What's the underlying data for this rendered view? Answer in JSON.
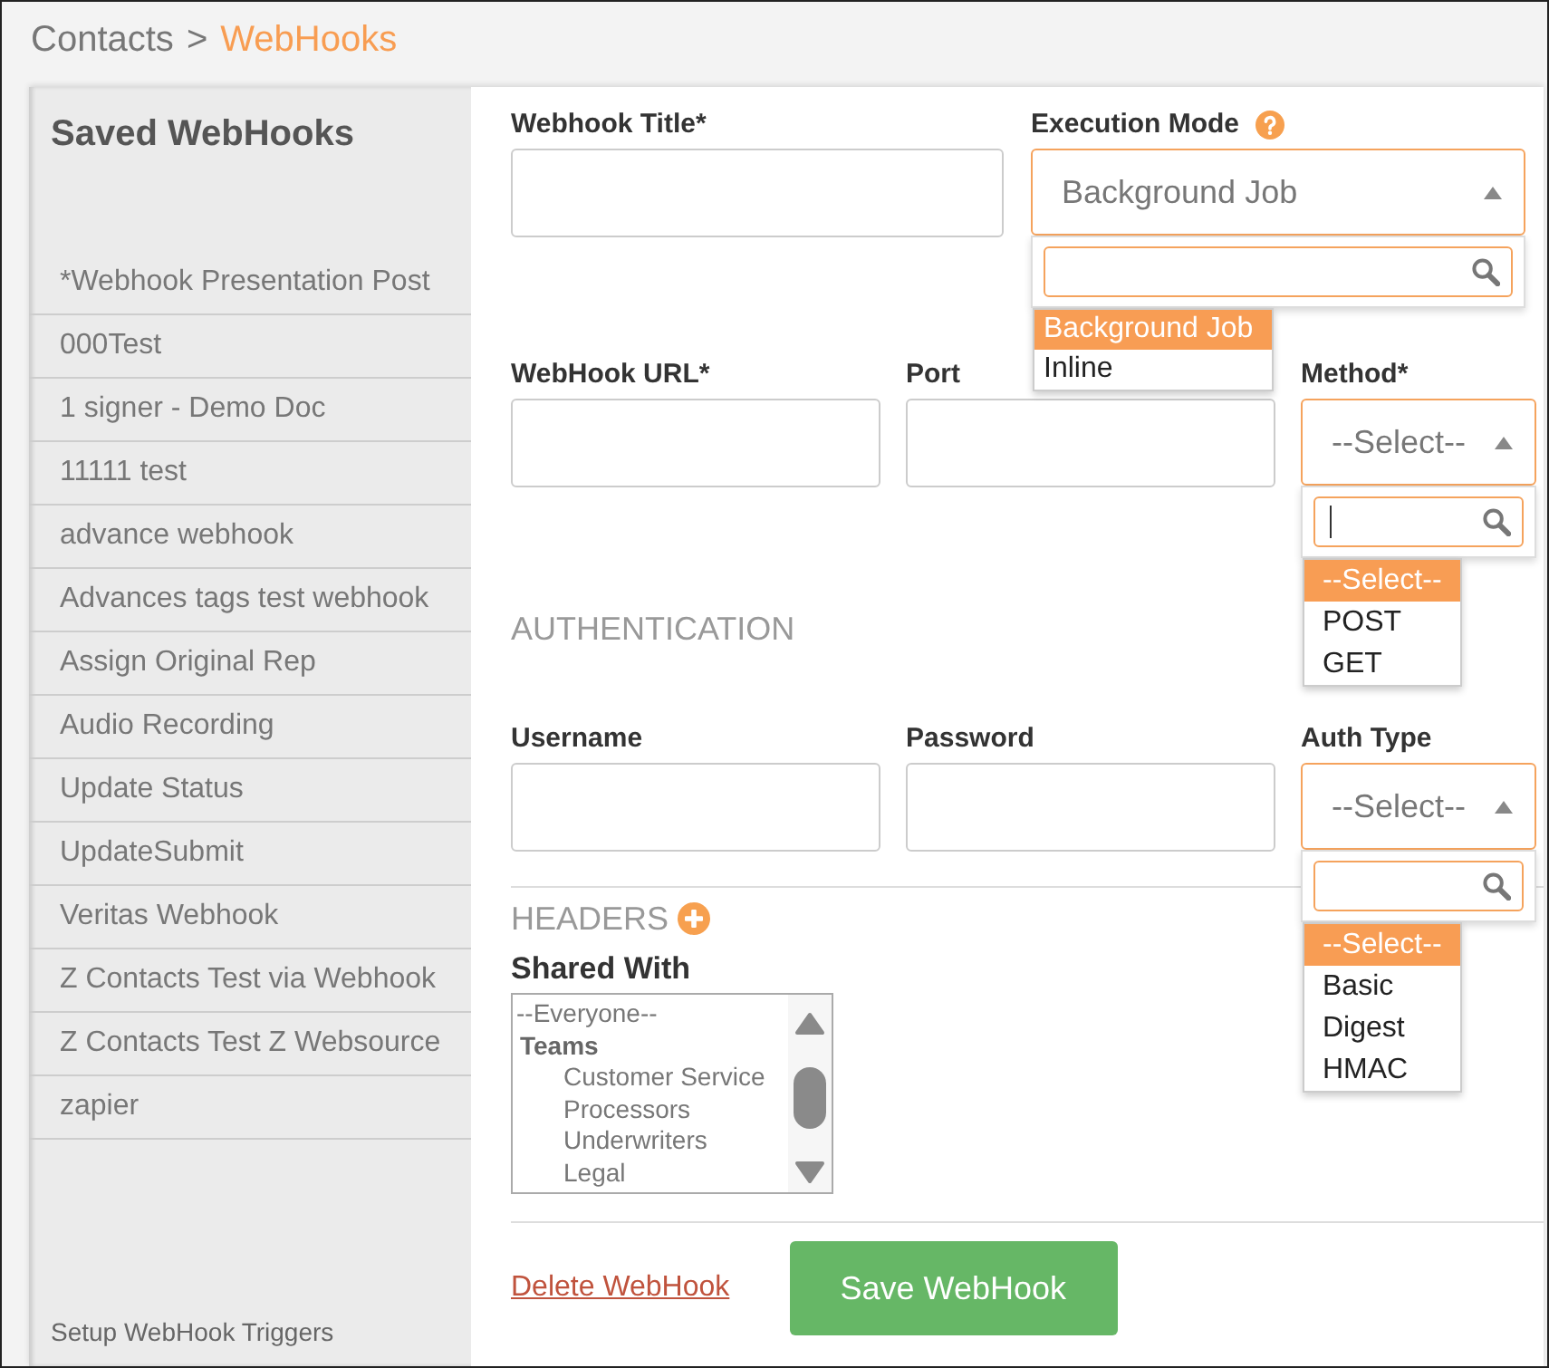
{
  "breadcrumb": {
    "items": [
      {
        "label": "Contacts",
        "current": false
      },
      {
        "label": "WebHooks",
        "current": true
      }
    ],
    "separator": ">"
  },
  "sidebar": {
    "title": "Saved WebHooks",
    "items": [
      "*Webhook Presentation Post",
      "000Test",
      "1 signer - Demo Doc",
      "11111 test",
      "advance webhook",
      "Advances tags test webhook",
      "Assign Original Rep",
      "Audio Recording",
      "Update Status",
      "UpdateSubmit",
      "Veritas Webhook",
      "Z Contacts Test via Webhook",
      "Z Contacts Test Z Websource",
      "zapier"
    ],
    "footer_link": "Setup WebHook Triggers"
  },
  "form": {
    "rows": [
      {
        "fields": [
          {
            "kind": "text",
            "label": "Webhook Title*"
          },
          {
            "kind": "select",
            "label": "Execution Mode",
            "help": true,
            "value": "Background Job",
            "expanded": true,
            "search_focused": false,
            "options": [
              {
                "label": "Background Job",
                "selected": true
              },
              {
                "label": "Inline",
                "selected": false
              }
            ]
          }
        ]
      },
      {
        "fields": [
          {
            "kind": "text",
            "label": "WebHook URL*"
          },
          {
            "kind": "text",
            "label": "Port"
          },
          {
            "kind": "select",
            "label": "Method*",
            "value": "--Select--",
            "expanded": true,
            "search_focused": true,
            "options": [
              {
                "label": "--Select--",
                "selected": true
              },
              {
                "label": "POST",
                "selected": false
              },
              {
                "label": "GET",
                "selected": false
              }
            ]
          }
        ]
      },
      {
        "heading": "AUTHENTICATION",
        "fields": [
          {
            "kind": "text",
            "label": "Username"
          },
          {
            "kind": "text",
            "label": "Password"
          },
          {
            "kind": "select",
            "label": "Auth Type",
            "value": "--Select--",
            "expanded": true,
            "search_focused": false,
            "options": [
              {
                "label": "--Select--",
                "selected": true
              },
              {
                "label": "Basic",
                "selected": false
              },
              {
                "label": "Digest",
                "selected": false
              },
              {
                "label": "HMAC",
                "selected": false
              }
            ]
          }
        ]
      }
    ],
    "headers": {
      "label": "HEADERS"
    },
    "shared_with": {
      "label": "Shared With",
      "options": [
        {
          "kind": "option",
          "label": "--Everyone--"
        },
        {
          "kind": "group",
          "label": "Teams",
          "children": [
            {
              "label": "Customer Service"
            },
            {
              "label": "Processors"
            },
            {
              "label": "Underwriters"
            },
            {
              "label": "Legal"
            }
          ]
        }
      ]
    },
    "actions": {
      "delete_link": "Delete WebHook",
      "save_button": "Save WebHook"
    }
  }
}
